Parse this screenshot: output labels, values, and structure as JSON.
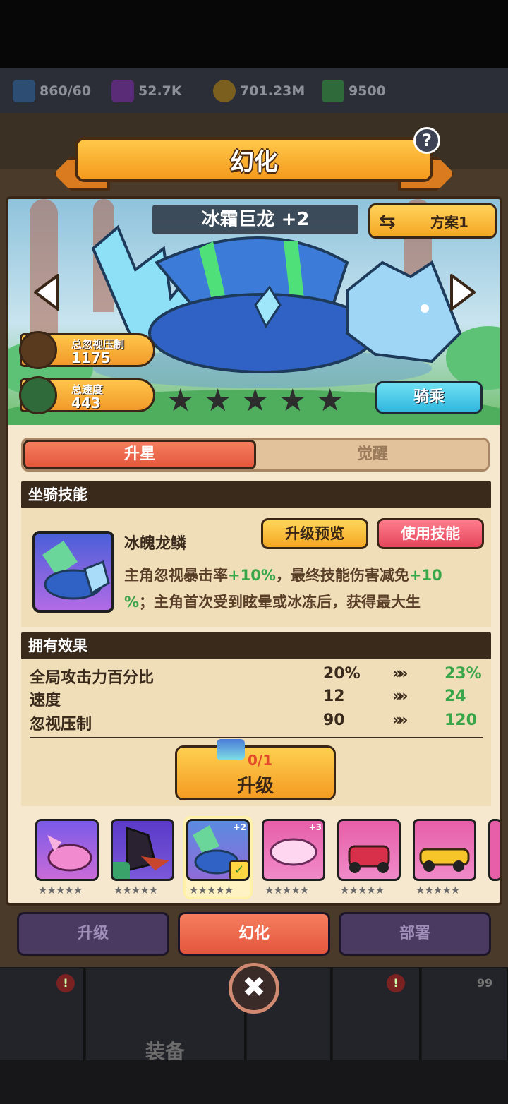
{
  "resources": [
    {
      "icon": "energy-icon",
      "value": "860/60"
    },
    {
      "icon": "gem-icon",
      "value": "52.7K"
    },
    {
      "icon": "coin-icon",
      "value": "701.23M"
    },
    {
      "icon": "token-icon",
      "value": "9500"
    }
  ],
  "bg_label": "装备",
  "bg_badge": "99",
  "dialog": {
    "title": "幻化",
    "help_label": "?"
  },
  "mount": {
    "name": "冰霜巨龙 +2",
    "plan_label": "方案1",
    "stats": [
      {
        "label": "总忽视压制",
        "value": "1175"
      },
      {
        "label": "总速度",
        "value": "443"
      }
    ],
    "stars_total": 5,
    "ride_label": "骑乘"
  },
  "tabs": {
    "active": "升星",
    "inactive": "觉醒"
  },
  "skill": {
    "section_title": "坐骑技能",
    "name": "冰魄龙鳞",
    "preview_label": "升级预览",
    "use_label": "使用技能",
    "desc_1": "主角忽视暴击率",
    "desc_2": "+10%",
    "desc_3": "，最终技能伤害减免",
    "desc_4": "+10",
    "desc_5": "%",
    "desc_6": "；主角首次受到眩晕或冰冻后，获得最大生"
  },
  "effects": {
    "section_title": "拥有效果",
    "rows": [
      {
        "name": "全局攻击力百分比",
        "current": "20%",
        "next": "23%"
      },
      {
        "name": "速度",
        "current": "12",
        "next": "24"
      },
      {
        "name": "忽视压制",
        "current": "90",
        "next": "120"
      }
    ],
    "arrow": "»"
  },
  "upgrade": {
    "count": "0/1",
    "label": "升级"
  },
  "cards": [
    {
      "name": "pink-dragon",
      "stars": "★★★★★",
      "color": "#c96bd8"
    },
    {
      "name": "dark-dragon",
      "stars": "★★★★★",
      "color": "#6a48c8"
    },
    {
      "name": "ice-dragon",
      "stars": "★★★★★",
      "color": "#5a8be0",
      "plus": "+2",
      "selected": true
    },
    {
      "name": "pink-cloud",
      "stars": "★★★★★",
      "color": "#e66ab0",
      "plus": "+3"
    },
    {
      "name": "go-kart",
      "stars": "★★★★★",
      "color": "#e66ab0"
    },
    {
      "name": "yellow-car",
      "stars": "★★★★★",
      "color": "#e66ab0"
    }
  ],
  "bottom_tabs": [
    "升级",
    "幻化",
    "部署"
  ],
  "close_label": "✖"
}
